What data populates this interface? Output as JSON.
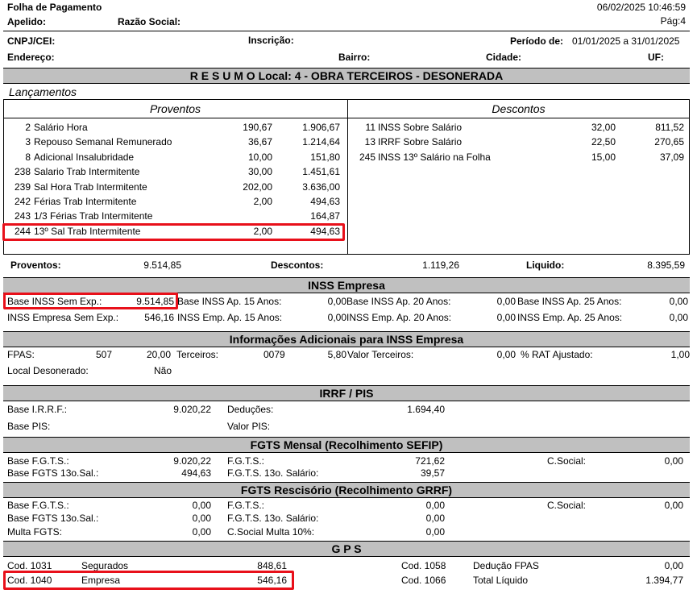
{
  "header": {
    "title": "Folha de Pagamento",
    "datetime": "06/02/2025 10:46:59",
    "apelido_label": "Apelido:",
    "razao_label": "Razão Social:",
    "page": "Pág:4",
    "cnpj_label": "CNPJ/CEI:",
    "inscricao_label": "Inscrição:",
    "periodo_label": "Período de:",
    "periodo_value": "01/01/2025 a 31/01/2025",
    "endereco_label": "Endereço:",
    "bairro_label": "Bairro:",
    "cidade_label": "Cidade:",
    "uf_label": "UF:"
  },
  "resumo_title": "R E S U M O Local: 4 - OBRA TERCEIROS - DESONERADA",
  "lancamentos_label": "Lançamentos",
  "proventos_header": "Proventos",
  "descontos_header": "Descontos",
  "proventos": [
    {
      "code": "2",
      "desc": "Salário Hora",
      "ref": "190,67",
      "value": "1.906,67"
    },
    {
      "code": "3",
      "desc": "Repouso Semanal Remunerado",
      "ref": "36,67",
      "value": "1.214,64"
    },
    {
      "code": "8",
      "desc": "Adicional Insalubridade",
      "ref": "10,00",
      "value": "151,80"
    },
    {
      "code": "238",
      "desc": "Salario Trab Intermitente",
      "ref": "30,00",
      "value": "1.451,61"
    },
    {
      "code": "239",
      "desc": "Sal Hora Trab Intermitente",
      "ref": "202,00",
      "value": "3.636,00"
    },
    {
      "code": "242",
      "desc": "Férias Trab Intermitente",
      "ref": "2,00",
      "value": "494,63"
    },
    {
      "code": "243",
      "desc": "1/3 Férias Trab Intermitente",
      "ref": "",
      "value": "164,87"
    },
    {
      "code": "244",
      "desc": "13º Sal Trab Intermitente",
      "ref": "2,00",
      "value": "494,63"
    }
  ],
  "descontos": [
    {
      "code": "11",
      "desc": "INSS Sobre Salário",
      "ref": "32,00",
      "value": "811,52"
    },
    {
      "code": "13",
      "desc": "IRRF Sobre Salário",
      "ref": "22,50",
      "value": "270,65"
    },
    {
      "code": "245",
      "desc": "INSS 13º Salário na Folha",
      "ref": "15,00",
      "value": "37,09"
    }
  ],
  "totals": {
    "proventos_label": "Proventos:",
    "proventos_value": "9.514,85",
    "descontos_label": "Descontos:",
    "descontos_value": "1.119,26",
    "liquido_label": "Liquido:",
    "liquido_value": "8.395,59"
  },
  "inss": {
    "title": "INSS Empresa",
    "row1": [
      {
        "label": "Base INSS Sem Exp.:",
        "value": "9.514,85"
      },
      {
        "label": "Base INSS Ap. 15 Anos:",
        "value": "0,00"
      },
      {
        "label": "Base INSS Ap. 20 Anos:",
        "value": "0,00"
      },
      {
        "label": "Base INSS Ap. 25 Anos:",
        "value": "0,00"
      }
    ],
    "row2": [
      {
        "label": "INSS Empresa Sem Exp.:",
        "value": "546,16"
      },
      {
        "label": "INSS Emp. Ap. 15 Anos:",
        "value": "0,00"
      },
      {
        "label": "INSS Emp. Ap. 20 Anos:",
        "value": "0,00"
      },
      {
        "label": "INSS Emp. Ap. 25 Anos:",
        "value": "0,00"
      }
    ]
  },
  "info": {
    "title": "Informações Adicionais para INSS Empresa",
    "fpas_label": "FPAS:",
    "fpas_value": "507",
    "fpas_rate": "20,00",
    "terceiros_label": "Terceiros:",
    "terceiros_value": "0079",
    "terceiros_rate": "5,80",
    "valor_terceiros_label": "Valor Terceiros:",
    "valor_terceiros_value": "0,00",
    "rat_label": "% RAT Ajustado:",
    "rat_value": "1,00",
    "desonerado_label": "Local Desonerado:",
    "desonerado_value": "Não"
  },
  "irrf": {
    "title": "IRRF / PIS",
    "base_irrf_label": "Base I.R.R.F.:",
    "base_irrf_value": "9.020,22",
    "deducoes_label": "Deduções:",
    "deducoes_value": "1.694,40",
    "base_pis_label": "Base PIS:",
    "valor_pis_label": "Valor PIS:"
  },
  "fgts_mensal": {
    "title": "FGTS Mensal (Recolhimento SEFIP)",
    "base_label": "Base F.G.T.S.:",
    "base_value": "9.020,22",
    "fgts_label": "F.G.T.S.:",
    "fgts_value": "721,62",
    "csocial_label": "C.Social:",
    "csocial_value": "0,00",
    "base13_label": "Base FGTS 13o.Sal.:",
    "base13_value": "494,63",
    "fgts13_label": "F.G.T.S. 13o. Salário:",
    "fgts13_value": "39,57"
  },
  "fgts_resc": {
    "title": "FGTS Rescisório (Recolhimento GRRF)",
    "base_label": "Base F.G.T.S.:",
    "base_value": "0,00",
    "fgts_label": "F.G.T.S.:",
    "fgts_value": "0,00",
    "csocial_label": "C.Social:",
    "csocial_value": "0,00",
    "base13_label": "Base FGTS 13o.Sal.:",
    "base13_value": "0,00",
    "fgts13_label": "F.G.T.S. 13o. Salário:",
    "fgts13_value": "0,00",
    "multa_label": "Multa FGTS:",
    "multa_value": "0,00",
    "csocial_multa_label": "C.Social Multa 10%:",
    "csocial_multa_value": "0,00"
  },
  "gps": {
    "title": "G P S",
    "rows_left": [
      {
        "code": "Cod. 1031",
        "label": "Segurados",
        "value": "848,61"
      },
      {
        "code": "Cod. 1040",
        "label": "Empresa",
        "value": "546,16"
      }
    ],
    "rows_right": [
      {
        "code": "Cod. 1058",
        "label": "Dedução FPAS",
        "value": "0,00"
      },
      {
        "code": "Cod. 1066",
        "label": "Total Líquido",
        "value": "1.394,77"
      }
    ]
  },
  "highlight_color": "#e8101a",
  "band_color": "#c0c0c0"
}
